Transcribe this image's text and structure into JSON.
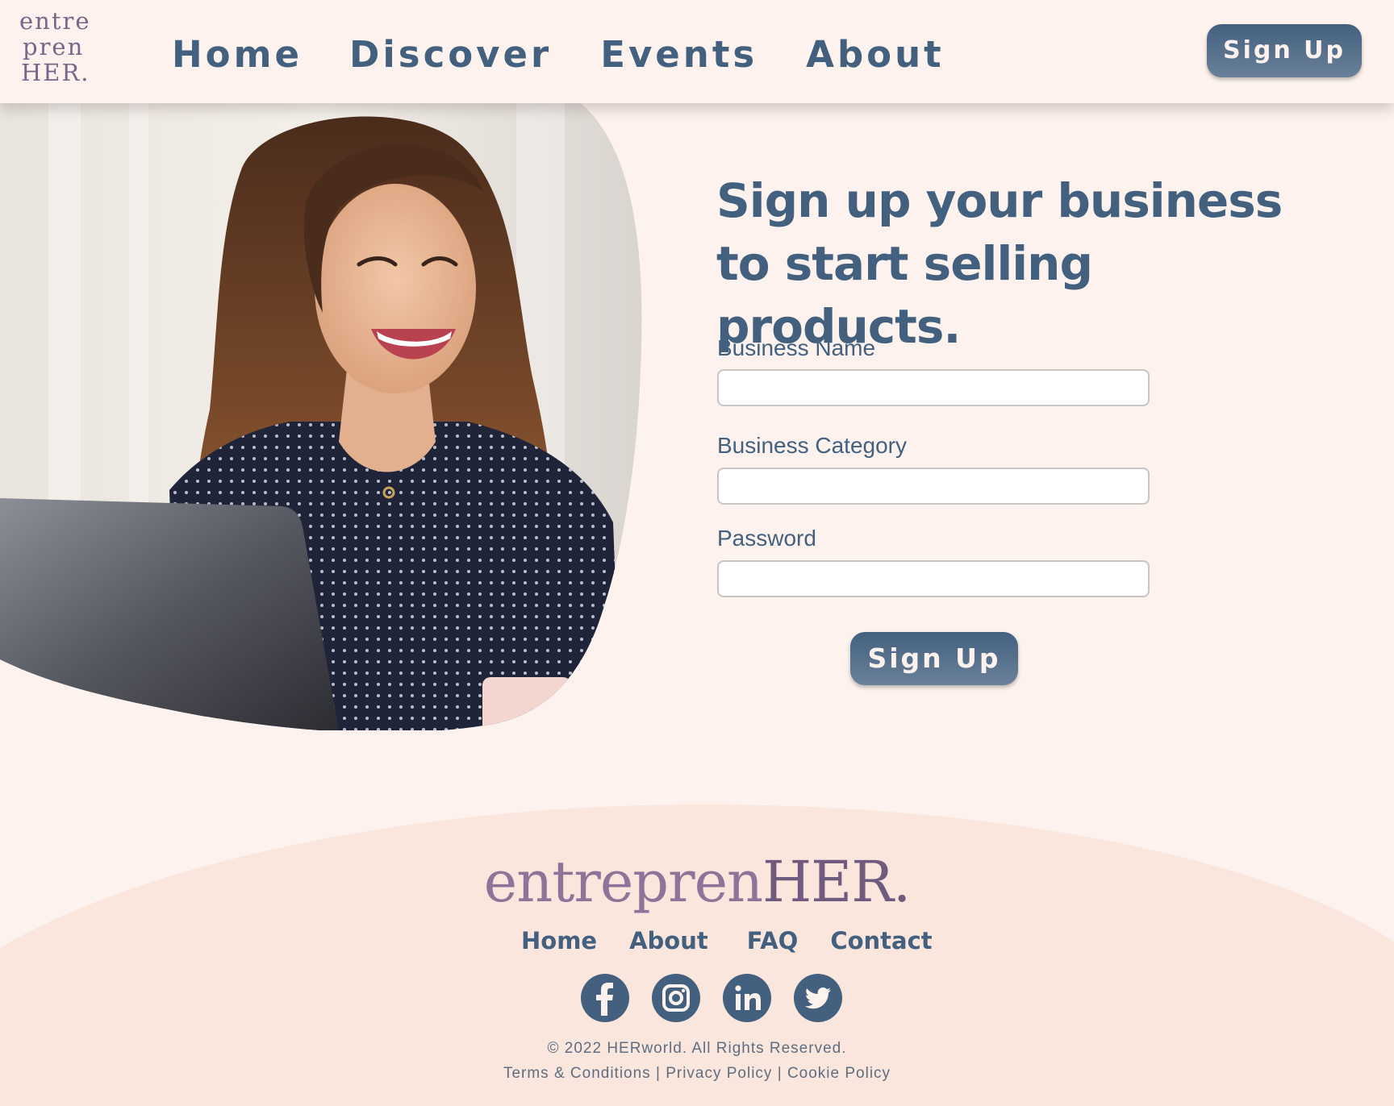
{
  "header": {
    "logo_lines": [
      "entre",
      "pren",
      "HER."
    ],
    "nav": [
      "Home",
      "Discover",
      "Events",
      "About"
    ],
    "signup_label": "Sign Up"
  },
  "form": {
    "heading": "Sign up your business to start selling products.",
    "business_name_label": "Business Name",
    "business_name_value": "",
    "business_category_label": "Business Category",
    "business_category_value": "",
    "password_label": "Password",
    "password_value": "",
    "submit_label": "Sign Up"
  },
  "footer": {
    "logo_prefix": "entrepren",
    "logo_suffix": "HER.",
    "nav": [
      "Home",
      "About",
      "FAQ",
      "Contact"
    ],
    "socials": [
      "facebook-icon",
      "instagram-icon",
      "linkedin-icon",
      "twitter-icon"
    ],
    "copyright": "© 2022 HERworld. All Rights Reserved.",
    "legal": [
      "Terms & Conditions",
      "Privacy Policy",
      "Cookie Policy"
    ],
    "legal_separator": "|"
  },
  "colors": {
    "background": "#fdf2ed",
    "footer_band": "#fbe6de",
    "primary": "#43617f",
    "logo_purple": "#7a6689"
  }
}
